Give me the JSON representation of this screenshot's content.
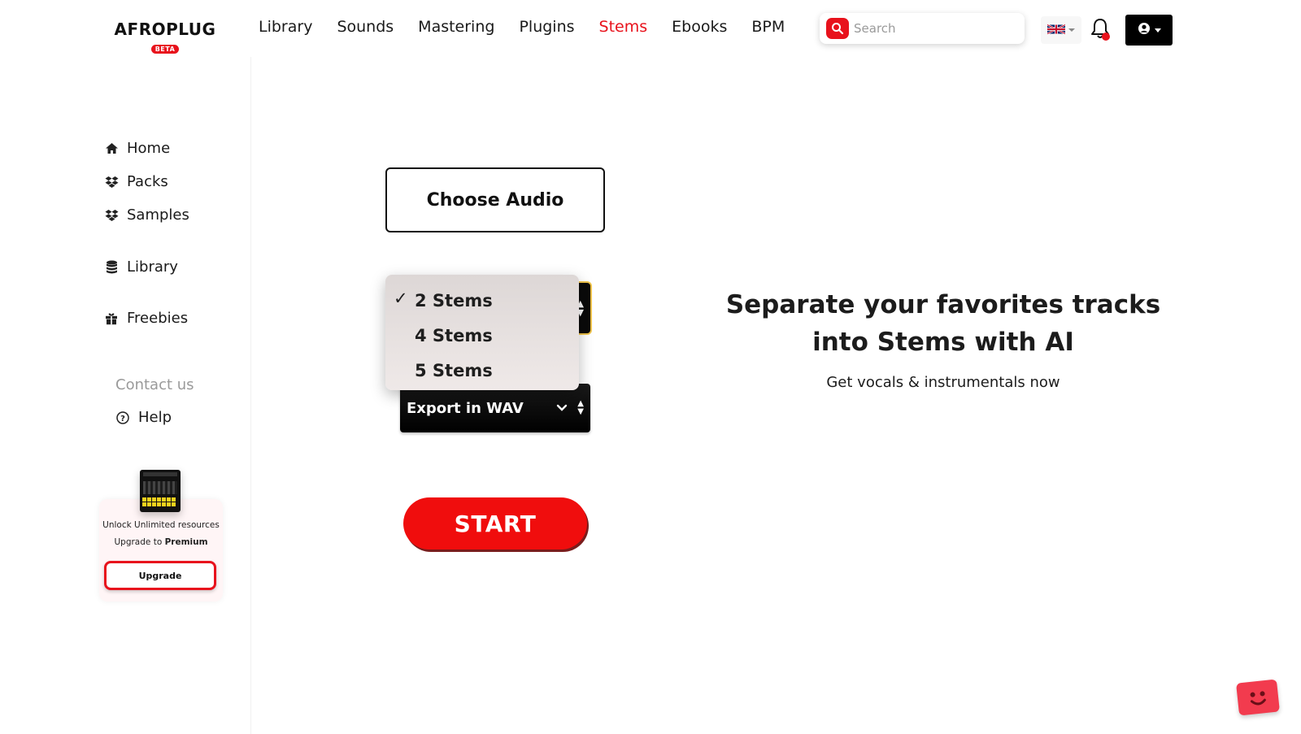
{
  "brand": {
    "name": "AFROPLUG",
    "badge": "BETA"
  },
  "topnav": {
    "items": [
      {
        "label": "Library",
        "active": false
      },
      {
        "label": "Sounds",
        "active": false
      },
      {
        "label": "Mastering",
        "active": false
      },
      {
        "label": "Plugins",
        "active": false
      },
      {
        "label": "Stems",
        "active": true
      },
      {
        "label": "Ebooks",
        "active": false
      },
      {
        "label": "BPM",
        "active": false
      }
    ]
  },
  "search": {
    "placeholder": "Search",
    "value": ""
  },
  "header": {
    "language_icon": "uk-flag-icon",
    "notification_icon": "bell-icon",
    "account_icon": "user-circle-icon"
  },
  "sidebar": {
    "items": [
      {
        "label": "Home",
        "icon": "home-icon"
      },
      {
        "label": "Packs",
        "icon": "dropbox-icon"
      },
      {
        "label": "Samples",
        "icon": "dropbox-icon"
      },
      {
        "label": "Library",
        "icon": "database-icon"
      },
      {
        "label": "Freebies",
        "icon": "gift-icon"
      }
    ],
    "contact": "Contact us",
    "help": "Help",
    "promo": {
      "line1": "Unlock Unlimited resources",
      "line2_prefix": "Upgrade to ",
      "line2_bold": "Premium",
      "button": "Upgrade"
    }
  },
  "main": {
    "choose_audio": "Choose Audio",
    "stems_options": [
      {
        "label": "2 Stems",
        "selected": true
      },
      {
        "label": "4 Stems",
        "selected": false
      },
      {
        "label": "5 Stems",
        "selected": false
      }
    ],
    "check_mark": "✓",
    "export_select": {
      "label": "Export in WAV"
    },
    "start": "START",
    "headline_line1": "Separate your favorites tracks",
    "headline_line2": "into Stems with AI",
    "subline": "Get vocals & instrumentals now"
  },
  "colors": {
    "accent": "#e8121c",
    "dark": "#000000",
    "dropdown_bg": "#e6e0df"
  }
}
